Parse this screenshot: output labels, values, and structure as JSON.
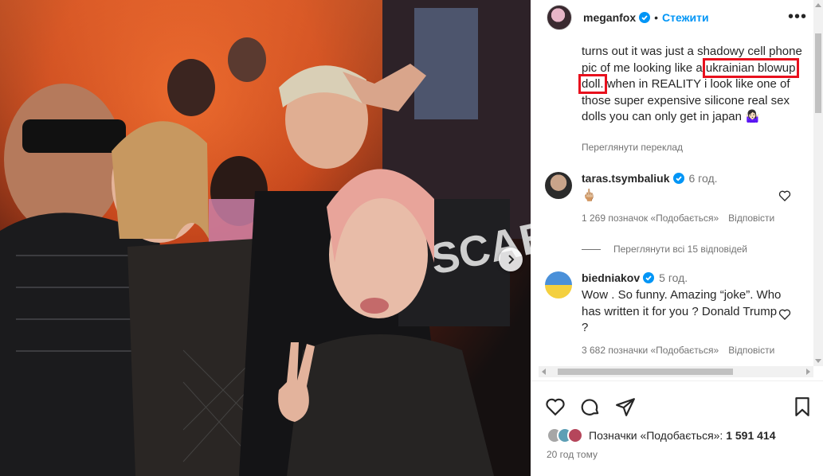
{
  "header": {
    "username": "meganfox",
    "separator": "•",
    "follow_label": "Стежити",
    "more_label": "•••"
  },
  "caption": {
    "text_before": "turns out it was just a shadowy cell phone pic of me looking like a ",
    "highlighted": "ukrainian blowup doll.",
    "text_after": " when in REALITY i look like one of those super expensive silicone real sex dolls you can only get in japan 🤷🏻‍♀️",
    "translate_label": "Переглянути переклад",
    "highlight_color": "#e8101d"
  },
  "comments": [
    {
      "username": "taras.tsymbaliuk",
      "verified": true,
      "time": "6 год.",
      "text": "🖕🏼",
      "likes": "1 269 позначок «Подобається»",
      "reply_label": "Відповісти"
    },
    {
      "username": "biedniakov",
      "verified": true,
      "time": "5 год.",
      "text": "Wow . So funny. Amazing “joke”. Who has written it for you ? Donald Trump ?",
      "likes": "3 682 позначки «Подобається»",
      "reply_label": "Відповісти"
    }
  ],
  "view_replies_label": "Переглянути всі 15 відповідей",
  "actions": {
    "like_icon": "heart-icon",
    "comment_icon": "comment-icon",
    "share_icon": "share-icon",
    "save_icon": "bookmark-icon"
  },
  "likes_summary": {
    "label": "Позначки «Подобається»: ",
    "count": "1 591 414"
  },
  "time_ago": "20 год тому",
  "colors": {
    "accent": "#0095f6",
    "verified": "#0095f6",
    "muted": "#737373",
    "text": "#262626"
  }
}
